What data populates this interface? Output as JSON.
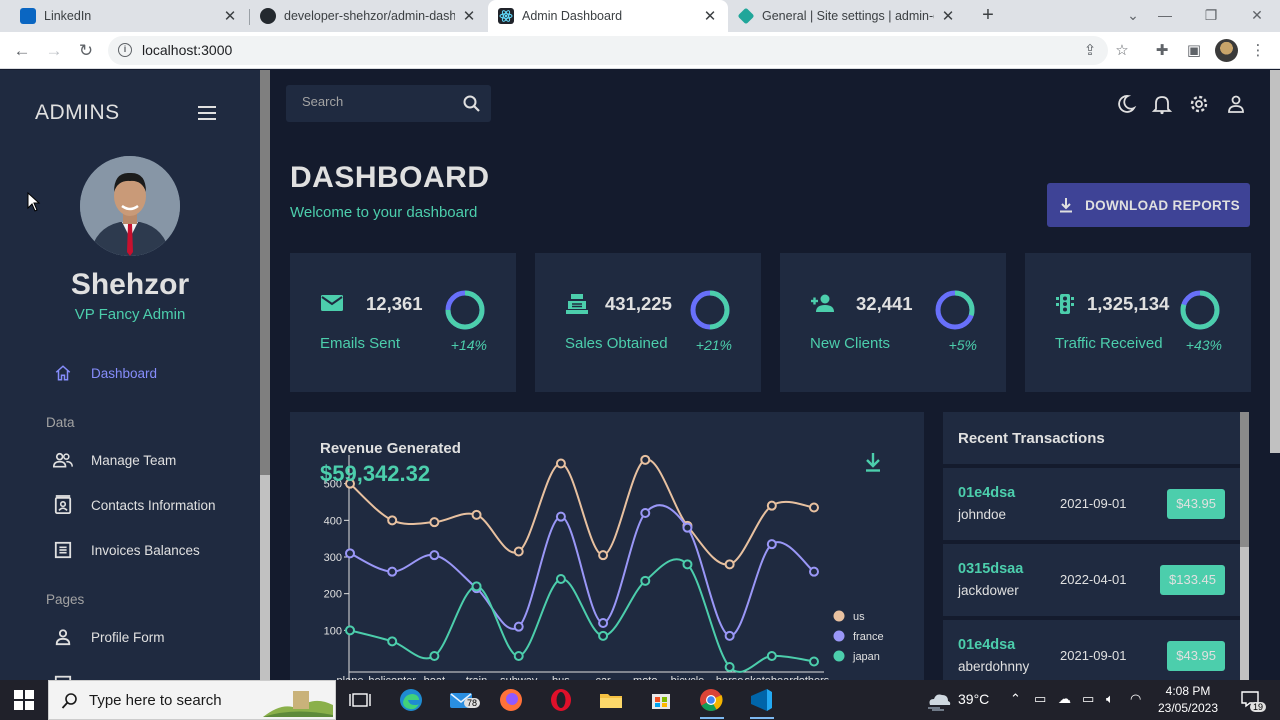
{
  "browser": {
    "tabs": [
      {
        "title": "LinkedIn",
        "active": false
      },
      {
        "title": "developer-shehzor/admin-dashb",
        "active": false
      },
      {
        "title": "Admin Dashboard",
        "active": true
      },
      {
        "title": "General | Site settings | admin-da",
        "active": false
      }
    ],
    "url": "localhost:3000"
  },
  "sidebar": {
    "brand": "ADMINS",
    "user_name": "Shehzor",
    "user_role": "VP Fancy Admin",
    "items": [
      {
        "label": "Dashboard",
        "active": true
      },
      {
        "label": "Manage Team"
      },
      {
        "label": "Contacts Information"
      },
      {
        "label": "Invoices Balances"
      },
      {
        "label": "Profile Form"
      }
    ],
    "sections": [
      "Data",
      "Pages"
    ]
  },
  "topbar": {
    "search_placeholder": "Search"
  },
  "header": {
    "title": "DASHBOARD",
    "subtitle": "Welcome to your dashboard",
    "download_label": "DOWNLOAD REPORTS"
  },
  "stats": [
    {
      "value": "12,361",
      "label": "Emails Sent",
      "increase": "+14%",
      "progress": 0.75,
      "icon": "email-icon"
    },
    {
      "value": "431,225",
      "label": "Sales Obtained",
      "increase": "+21%",
      "progress": 0.5,
      "icon": "point-of-sale-icon"
    },
    {
      "value": "32,441",
      "label": "New Clients",
      "increase": "+5%",
      "progress": 0.3,
      "icon": "person-add-icon"
    },
    {
      "value": "1,325,134",
      "label": "Traffic Received",
      "increase": "+43%",
      "progress": 0.8,
      "icon": "traffic-icon"
    }
  ],
  "revenue": {
    "title": "Revenue Generated",
    "amount": "$59,342.32"
  },
  "chart_data": {
    "type": "line",
    "categories": [
      "plane",
      "helicopter",
      "boat",
      "train",
      "subway",
      "bus",
      "car",
      "moto",
      "bicycle",
      "horse",
      "skateboard",
      "others"
    ],
    "ylim": [
      0,
      600
    ],
    "yticks": [
      100,
      200,
      300,
      400,
      500
    ],
    "legend": "bottom-right",
    "series": [
      {
        "name": "us",
        "color": "#e8c1a0",
        "values": [
          500,
          400,
          395,
          415,
          315,
          555,
          305,
          565,
          385,
          280,
          440,
          435
        ]
      },
      {
        "name": "france",
        "color": "#9a97f7",
        "values": [
          310,
          260,
          305,
          215,
          110,
          410,
          120,
          420,
          380,
          85,
          335,
          260
        ]
      },
      {
        "name": "japan",
        "color": "#4cceac",
        "values": [
          100,
          70,
          30,
          220,
          30,
          240,
          85,
          235,
          280,
          0,
          30,
          15
        ]
      }
    ]
  },
  "transactions": {
    "title": "Recent Transactions",
    "rows": [
      {
        "id": "01e4dsa",
        "user": "johndoe",
        "date": "2021-09-01",
        "cost": "$43.95"
      },
      {
        "id": "0315dsaa",
        "user": "jackdower",
        "date": "2022-04-01",
        "cost": "$133.45"
      },
      {
        "id": "01e4dsa",
        "user": "aberdohnny",
        "date": "2021-09-01",
        "cost": "$43.95"
      }
    ]
  },
  "taskbar": {
    "search_placeholder": "Type here to search",
    "weather": "39°C",
    "time": "4:08 PM",
    "date": "23/05/2023",
    "mail_badge": "78",
    "notif_count": "19"
  }
}
